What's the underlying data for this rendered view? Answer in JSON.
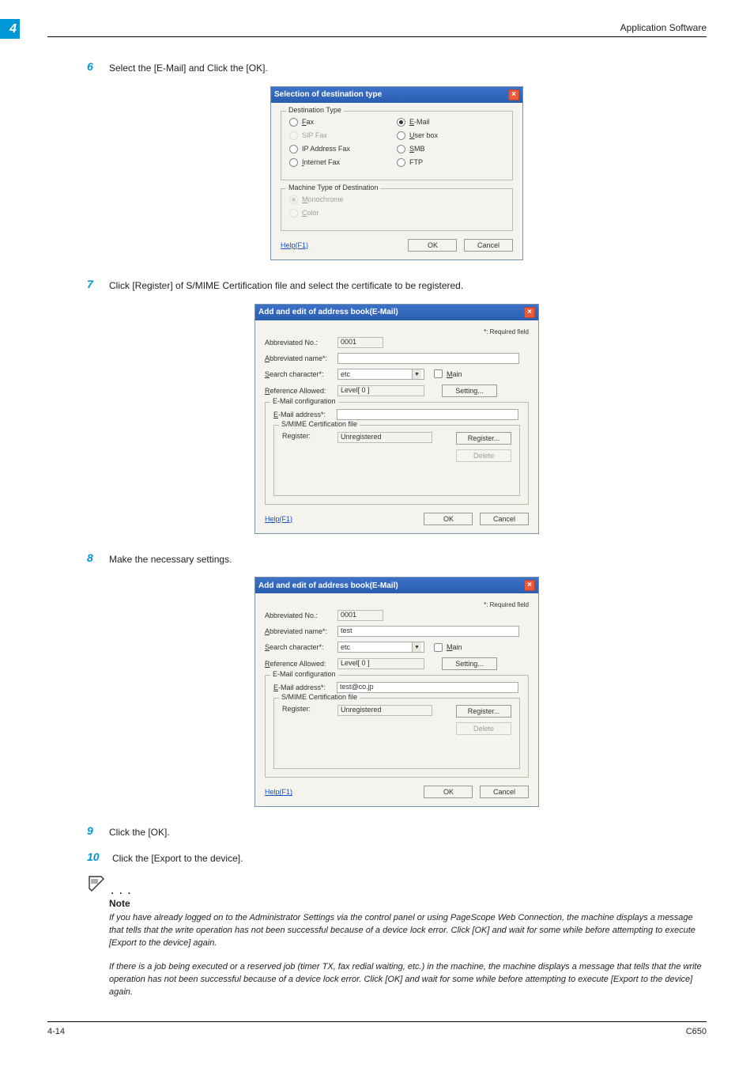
{
  "header": {
    "chapter_num": "4",
    "section_title": "Application Software"
  },
  "steps": {
    "s6": {
      "num": "6",
      "text": "Select the [E-Mail] and Click the [OK]."
    },
    "s7": {
      "num": "7",
      "text": "Click [Register] of S/MIME Certification file and select the certificate to be registered."
    },
    "s8": {
      "num": "8",
      "text": "Make the necessary settings."
    },
    "s9": {
      "num": "9",
      "text": "Click the [OK]."
    },
    "s10": {
      "num": "10",
      "text": "Click the [Export to the device]."
    }
  },
  "dialog1": {
    "title": "Selection of destination type",
    "group_dest": "Destination Type",
    "opt_fax": "Fax",
    "opt_sipfax": "SIP Fax",
    "opt_ipaddrfax": "IP Address Fax",
    "opt_internetfax": "Internet Fax",
    "opt_email": "E-Mail",
    "opt_userbox": "User box",
    "opt_smb": "SMB",
    "opt_ftp": "FTP",
    "group_machine": "Machine Type of Destination",
    "opt_mono": "Monochrome",
    "opt_color": "Color",
    "help": "Help(F1)",
    "ok": "OK",
    "cancel": "Cancel"
  },
  "dialog2": {
    "title": "Add and edit of address book(E-Mail)",
    "required": "*: Required field",
    "lbl_abbr_no": "Abbreviated No.:",
    "val_abbr_no": "0001",
    "lbl_abbr_name": "Abbreviated name*:",
    "val_abbr_name": "",
    "lbl_search": "Search character*:",
    "val_search": "etc",
    "chk_main": "Main",
    "lbl_refallowed": "Reference Allowed:",
    "val_refallowed": "Level[ 0 ]",
    "btn_setting": "Setting...",
    "grp_email": "E-Mail configuration",
    "lbl_email": "E-Mail address*:",
    "val_email": "",
    "grp_smime": "S/MIME Certification file",
    "lbl_register": "Register:",
    "val_register": "Unregistered",
    "btn_register": "Register...",
    "btn_delete": "Delete",
    "help": "Help(F1)",
    "ok": "OK",
    "cancel": "Cancel"
  },
  "dialog3": {
    "title": "Add and edit of address book(E-Mail)",
    "required": "*: Required field",
    "lbl_abbr_no": "Abbreviated No.:",
    "val_abbr_no": "0001",
    "lbl_abbr_name": "Abbreviated name*:",
    "val_abbr_name": "test",
    "lbl_search": "Search character*:",
    "val_search": "etc",
    "chk_main": "Main",
    "lbl_refallowed": "Reference Allowed:",
    "val_refallowed": "Level[ 0 ]",
    "btn_setting": "Setting...",
    "grp_email": "E-Mail configuration",
    "lbl_email": "E-Mail address*:",
    "val_email": "test@co.jp",
    "grp_smime": "S/MIME Certification file",
    "lbl_register": "Register:",
    "val_register": "Unregistered",
    "btn_register": "Register...",
    "btn_delete": "Delete",
    "help": "Help(F1)",
    "ok": "OK",
    "cancel": "Cancel"
  },
  "note": {
    "heading": "Note",
    "para1": "If you have already logged on to the Administrator Settings via the control panel or using PageScope Web Connection, the machine displays a message that tells that the write operation has not been successful because of a device lock error. Click [OK] and wait for some while before attempting to execute [Export to the device] again.",
    "para2": "If there is a job being executed or a reserved job (timer TX, fax redial waiting, etc.) in the machine, the machine displays a message that tells that the write operation has not been successful because of a device lock error. Click [OK] and wait for some while before attempting to execute [Export to the device] again."
  },
  "footer": {
    "left": "4-14",
    "right": "C650"
  }
}
